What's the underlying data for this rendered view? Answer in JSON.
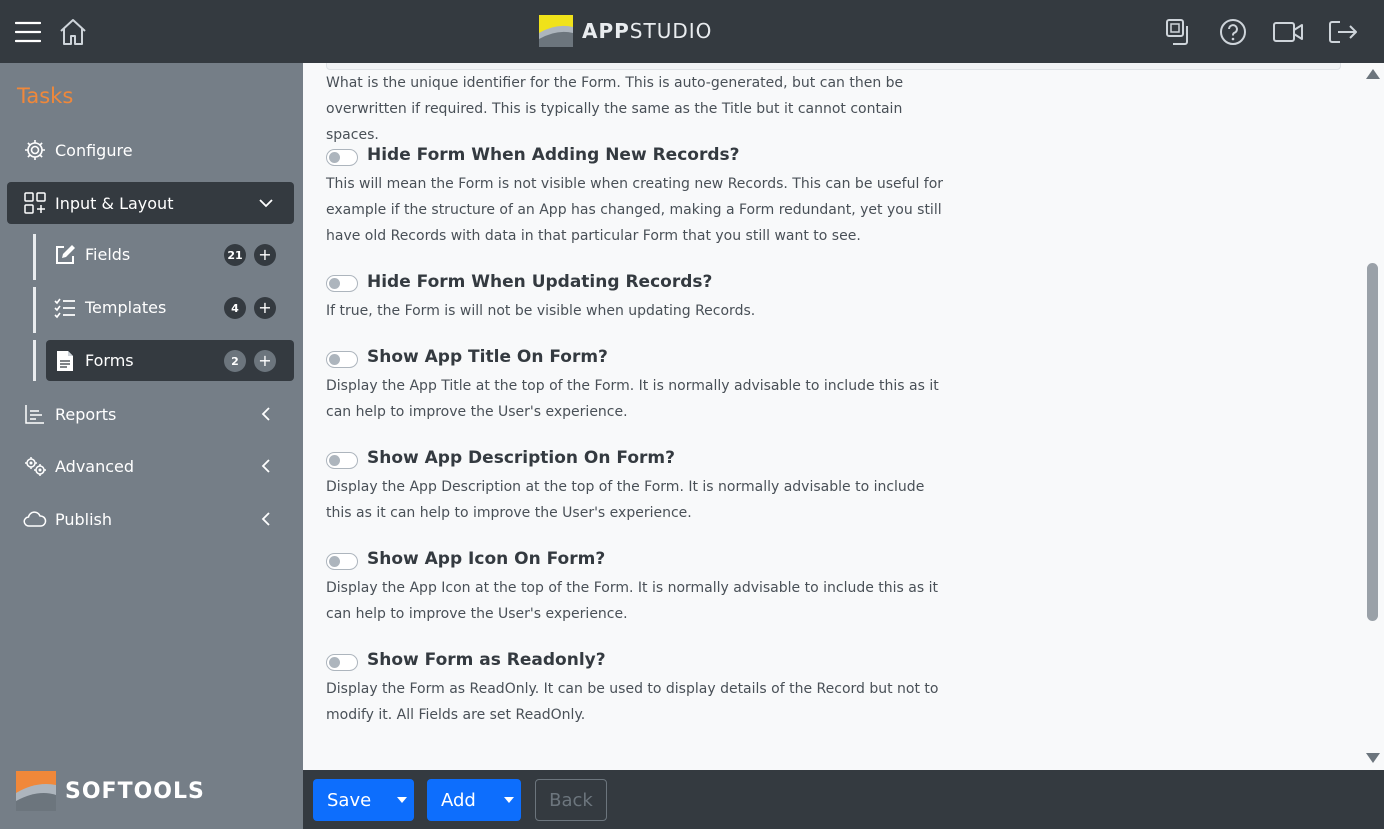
{
  "header": {
    "brand_bold": "APP",
    "brand_light": "STUDIO",
    "icons": [
      "hamburger-icon",
      "home-icon",
      "copy-icon",
      "help-icon",
      "video-icon",
      "logout-icon"
    ]
  },
  "sidebar": {
    "title": "Tasks",
    "items": [
      {
        "label": "Configure",
        "icon": "gear-icon"
      },
      {
        "label": "Input & Layout",
        "icon": "layout-add-icon"
      },
      {
        "label": "Reports",
        "icon": "chart-icon"
      },
      {
        "label": "Advanced",
        "icon": "gears-icon"
      },
      {
        "label": "Publish",
        "icon": "cloud-icon"
      }
    ],
    "sub_items": [
      {
        "label": "Fields",
        "count": "21",
        "icon": "edit-icon"
      },
      {
        "label": "Templates",
        "count": "4",
        "icon": "checklist-icon"
      },
      {
        "label": "Forms",
        "count": "2",
        "icon": "document-icon"
      }
    ],
    "plus_symbol": "+",
    "footer_brand": "SOFTOOLS"
  },
  "content": {
    "intro_desc": "What is the unique identifier for the Form. This is auto-generated, but can then be overwritten if required. This is typically the same as the Title but it cannot contain spaces.",
    "options": [
      {
        "title": "Hide Form When Adding New Records?",
        "desc": "This will mean the Form is not visible when creating new Records. This can be useful for example if the structure of an App has changed, making a Form redundant, yet you still have old Records with data in that particular Form that you still want to see.",
        "checked": false
      },
      {
        "title": "Hide Form When Updating Records?",
        "desc": "If true, the Form is will not be visible when updating Records.",
        "checked": false
      },
      {
        "title": "Show App Title On Form?",
        "desc": "Display the App Title at the top of the Form. It is normally advisable to include this as it can help to improve the User's experience.",
        "checked": false
      },
      {
        "title": "Show App Description On Form?",
        "desc": "Display the App Description at the top of the Form. It is normally advisable to include this as it can help to improve the User's experience.",
        "checked": false
      },
      {
        "title": "Show App Icon On Form?",
        "desc": "Display the App Icon at the top of the Form. It is normally advisable to include this as it can help to improve the User's experience.",
        "checked": false
      },
      {
        "title": "Show Form as Readonly?",
        "desc": "Display the Form as ReadOnly. It can be used to display details of the Record but not to modify it. All Fields are set ReadOnly.",
        "checked": false
      }
    ]
  },
  "footer": {
    "save_label": "Save",
    "add_label": "Add",
    "back_label": "Back"
  },
  "colors": {
    "topbar": "#343a40",
    "sidebar": "#757e87",
    "accent": "#f0883a",
    "primary": "#0d6efd"
  }
}
